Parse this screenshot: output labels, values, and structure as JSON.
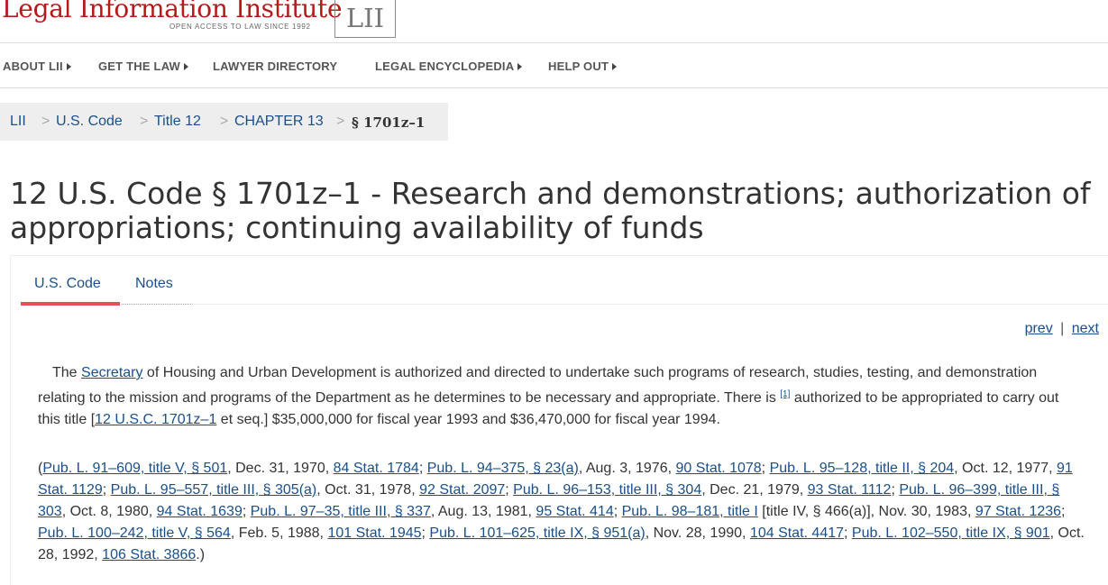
{
  "header": {
    "logo_title": "Legal Information Institute",
    "logo_subtitle": "OPEN ACCESS TO LAW SINCE 1992",
    "logo_badge": "[LII]"
  },
  "nav": {
    "items": [
      {
        "label": "ABOUT LII",
        "has_caret": true
      },
      {
        "label": "GET THE LAW",
        "has_caret": true
      },
      {
        "label": "LAWYER DIRECTORY",
        "has_caret": false
      },
      {
        "label": "LEGAL ENCYCLOPEDIA",
        "has_caret": true
      },
      {
        "label": "HELP OUT",
        "has_caret": true
      }
    ]
  },
  "breadcrumb": {
    "separator": ">",
    "items": [
      "LII",
      "U.S. Code",
      "Title 12",
      "CHAPTER 13"
    ],
    "current": "§ 1701z–1"
  },
  "page_title": "12 U.S. Code § 1701z–1 - Research and demonstrations; authorization of appropriations; continuing availability of funds",
  "tabs": [
    {
      "label": "U.S. Code",
      "active": true
    },
    {
      "label": "Notes",
      "active": false
    }
  ],
  "pager": {
    "prev": "prev",
    "separator": "|",
    "next": "next"
  },
  "body": {
    "text_1": "The ",
    "link_secretary": "Secretary",
    "text_2": " of Housing and Urban Development is authorized and directed to undertake such programs of research, studies, testing, and demonstration relating to the mission and programs of the Department as he determines to be necessary and appropriate. There is ",
    "footnote": "[1]",
    "text_3": " authorized to be appropriated to carry out this title [",
    "link_usc": "12 U.S.C. 1701z–1",
    "text_4": " et seq.] $35,000,000 for fiscal year 1993 and $36,470,000 for fiscal year 1994."
  },
  "citations": {
    "open": "(",
    "c1": "Pub. L. 91–609, title V, § 501",
    "t1": ", Dec. 31, 1970, ",
    "c2": "84 Stat. 1784",
    "t2": "; ",
    "c3": "Pub. L. 94–375, § 23(a)",
    "t3": ", Aug. 3, 1976, ",
    "c4": "90 Stat. 1078",
    "t4": "; ",
    "c5": "Pub. L. 95–128, title II, § 204",
    "t5": ", Oct. 12, 1977, ",
    "c6": "91 Stat. 1129",
    "t6": "; ",
    "c7": "Pub. L. 95–557, title III, § 305(a)",
    "t7": ", Oct. 31, 1978, ",
    "c8": "92 Stat. 2097",
    "t8": "; ",
    "c9": "Pub. L. 96–153, title III, § 304",
    "t9": ", Dec. 21, 1979, ",
    "c10": "93 Stat. 1112",
    "t10": "; ",
    "c11": "Pub. L. 96–399, title III, § 303",
    "t11": ", Oct. 8, 1980, ",
    "c12": "94 Stat. 1639",
    "t12": "; ",
    "c13": "Pub. L. 97–35, title III, § 337",
    "t13": ", Aug. 13, 1981, ",
    "c14": "95 Stat. 414",
    "t14": "; ",
    "c15": "Pub. L. 98–181, title I",
    "t15": " [title IV, § 466(a)], Nov. 30, 1983, ",
    "c16": "97 Stat. 1236",
    "t16": "; ",
    "c17": "Pub. L. 100–242, title V, § 564",
    "t17": ", Feb. 5, 1988, ",
    "c18": "101 Stat. 1945",
    "t18": "; ",
    "c19": "Pub. L. 101–625, title IX, § 951(a)",
    "t19": ", Nov. 28, 1990, ",
    "c20": "104 Stat. 4417",
    "t20": "; ",
    "c21": "Pub. L. 102–550, title IX, § 901",
    "t21": ", Oct. 28, 1992, ",
    "c22": "106 Stat. 3866",
    "close": ".)"
  },
  "colors": {
    "accent_red": "#b31b1b",
    "link_blue": "#1a4f8a",
    "tab_underline": "#e0525a"
  }
}
